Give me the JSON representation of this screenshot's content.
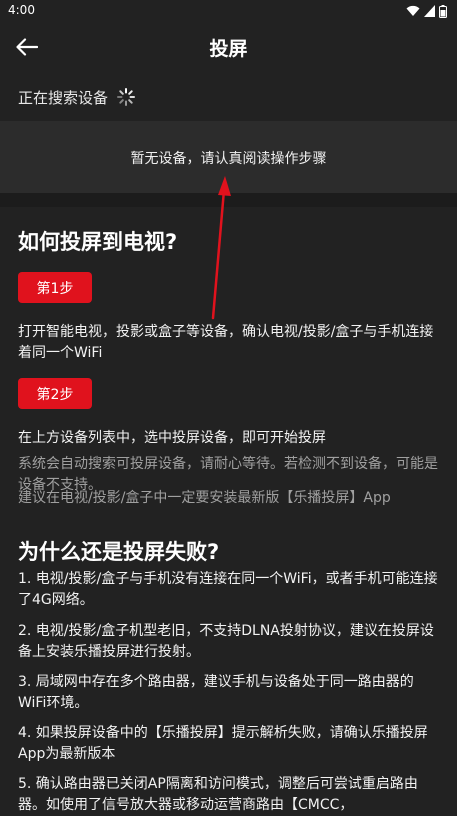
{
  "status_bar": {
    "time": "4:00"
  },
  "header": {
    "title": "投屏",
    "back_icon": "arrow-left-icon"
  },
  "search": {
    "status_text": "正在搜索设备"
  },
  "device_list": {
    "empty_text": "暂无设备，请认真阅读操作步骤"
  },
  "guide": {
    "title": "如何投屏到电视?",
    "step1_label": "第1步",
    "step1_text": "打开智能电视，投影或盒子等设备，确认电视/投影/盒子与手机连接着同一个WiFi",
    "step2_label": "第2步",
    "step2_text": "在上方设备列表中，选中投屏设备，即可开始投屏",
    "note1": "系统会自动搜索可投屏设备，请耐心等待。若检测不到设备，可能是设备不支持。",
    "note2": "建议在电视/投影/盒子中一定要安装最新版【乐播投屏】App"
  },
  "faq": {
    "title": "为什么还是投屏失败?",
    "items": [
      "1. 电视/投影/盒子与手机没有连接在同一个WiFi，或者手机可能连接了4G网络。",
      "2. 电视/投影/盒子机型老旧，不支持DLNA投射协议，建议在投屏设备上安装乐播投屏进行投射。",
      "3. 局域网中存在多个路由器，建议手机与设备处于同一路由器的WiFi环境。",
      "4. 如果投屏设备中的【乐播投屏】提示解析失败，请确认乐播投屏App为最新版本",
      "5. 确认路由器已关闭AP隔离和访问模式，调整后可尝试重启路由器。如使用了信号放大器或移动运营商路由【CMCC，"
    ]
  },
  "colors": {
    "background": "#222222",
    "panel": "#2c2c2c",
    "accent": "#e0121d",
    "muted_text": "#a0a0a0"
  }
}
